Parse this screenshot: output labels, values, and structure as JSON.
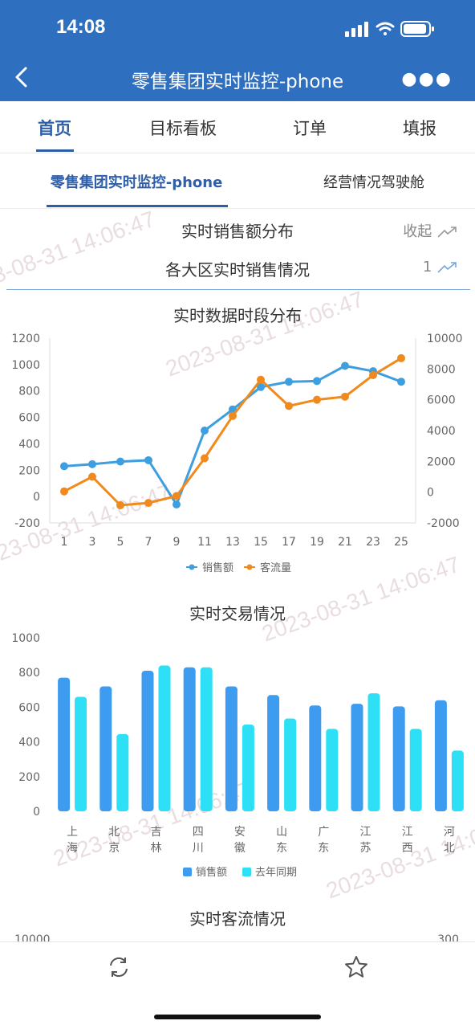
{
  "status": {
    "time": "14:08"
  },
  "nav": {
    "title": "零售集团实时监控-phone"
  },
  "tabs": [
    {
      "label": "首页",
      "active": true
    },
    {
      "label": "目标看板"
    },
    {
      "label": "订单"
    },
    {
      "label": "填报"
    }
  ],
  "subtabs": [
    {
      "label": "零售集团实时监控-phone",
      "active": true
    },
    {
      "label": "经营情况驾驶舱"
    }
  ],
  "section": {
    "title": "实时销售额分布",
    "collapse_label": "收起",
    "region_title": "各大区实时销售情况",
    "region_value": "1"
  },
  "watermark": "2023-08-31 14:06:47",
  "line_chart_title": "实时数据时段分布",
  "bar_chart_title": "实时交易情况",
  "traffic_title": "实时客流情况",
  "traffic_axis": {
    "left_top": "10000",
    "right_top": "300"
  },
  "colors": {
    "accent": "#2f6fc0",
    "sales": "#3e9fe0",
    "traffic": "#f08a1c",
    "bar_sales": "#3d9cf0",
    "bar_last": "#2ee0f5"
  },
  "chart_data": [
    {
      "type": "line",
      "title": "实时数据时段分布",
      "x": [
        1,
        3,
        5,
        7,
        9,
        11,
        13,
        15,
        17,
        19,
        21,
        23,
        25
      ],
      "series": [
        {
          "name": "销售额",
          "axis": "left",
          "values": [
            230,
            245,
            265,
            275,
            -60,
            500,
            660,
            830,
            870,
            875,
            990,
            950,
            870
          ]
        },
        {
          "name": "客流量",
          "axis": "right",
          "values": [
            50,
            1000,
            -850,
            -700,
            -250,
            2200,
            4950,
            7300,
            5600,
            6000,
            6200,
            7600,
            8700
          ]
        }
      ],
      "ylim": [
        -200,
        1200
      ],
      "yticks": [
        -200,
        0,
        200,
        400,
        600,
        800,
        1000,
        1200
      ],
      "y2lim": [
        -2000,
        10000
      ],
      "y2ticks": [
        -2000,
        0,
        2000,
        4000,
        6000,
        8000,
        10000
      ],
      "legend": "bottom",
      "grid": false
    },
    {
      "type": "bar",
      "title": "实时交易情况",
      "categories": [
        "上海",
        "北京",
        "吉林",
        "四川",
        "安徽",
        "山东",
        "广东",
        "江苏",
        "江西",
        "河北"
      ],
      "series": [
        {
          "name": "销售额",
          "values": [
            770,
            720,
            810,
            830,
            720,
            670,
            610,
            620,
            605,
            640
          ]
        },
        {
          "name": "去年同期",
          "values": [
            660,
            445,
            840,
            830,
            500,
            535,
            475,
            680,
            475,
            350
          ]
        }
      ],
      "ylim": [
        0,
        1000
      ],
      "yticks": [
        0,
        200,
        400,
        600,
        800,
        1000
      ],
      "legend": "bottom",
      "grid": false
    }
  ]
}
